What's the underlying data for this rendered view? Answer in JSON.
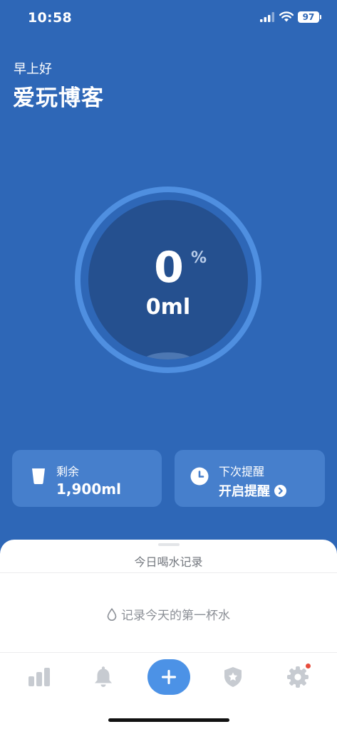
{
  "status_bar": {
    "time": "10:58",
    "battery": "97"
  },
  "header": {
    "greeting": "早上好",
    "username": "爱玩博客"
  },
  "progress": {
    "percent": "0",
    "percent_sign": "%",
    "volume": "0ml",
    "fraction": 0
  },
  "cards": {
    "remaining": {
      "label": "剩余",
      "value": "1,900ml",
      "icon": "cup-icon"
    },
    "reminder": {
      "label": "下次提醒",
      "action": "开启提醒",
      "icon": "clock-icon"
    }
  },
  "sheet": {
    "title": "今日喝水记录",
    "empty_text": "记录今天的第一杯水"
  },
  "tabs": [
    {
      "name": "stats",
      "icon": "bar-chart-icon"
    },
    {
      "name": "reminders",
      "icon": "bell-icon"
    },
    {
      "name": "add",
      "icon": "plus-icon"
    },
    {
      "name": "shield",
      "icon": "shield-icon"
    },
    {
      "name": "settings",
      "icon": "gear-icon",
      "badge": true
    }
  ],
  "colors": {
    "background": "#2e67b7",
    "ring": "#4f8fe0",
    "ring_inner": "#25508f",
    "card": "#467fcc",
    "accent_button": "#4c92e6",
    "badge": "#e74c3c",
    "tab_icon": "#c7cbd1"
  }
}
